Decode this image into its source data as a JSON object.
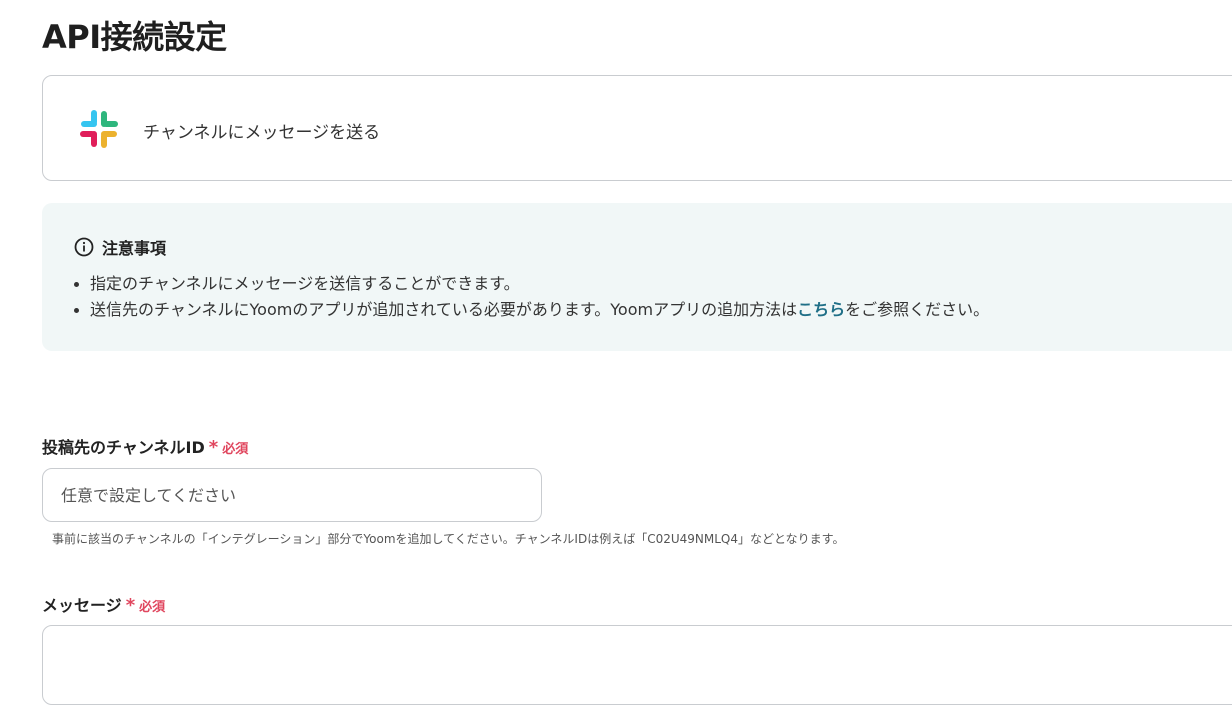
{
  "page": {
    "title": "API接続設定"
  },
  "action": {
    "label": "チャンネルにメッセージを送る",
    "app_icon": "slack-icon"
  },
  "notice": {
    "heading": "注意事項",
    "items": [
      {
        "text": "指定のチャンネルにメッセージを送信することができます。"
      },
      {
        "before": "送信先のチャンネルにYoomのアプリが追加されている必要があります。Yoomアプリの追加方法は",
        "link": "こちら",
        "after": "をご参照ください。"
      }
    ],
    "accent_color": "#1f6f87",
    "background_color": "#f1f7f7"
  },
  "fields": {
    "channel": {
      "label": "投稿先のチャンネルID",
      "required_mark": "*",
      "required_text": "必須",
      "placeholder": "任意で設定してください",
      "hint": "事前に該当のチャンネルの「インテグレーション」部分でYoomを追加してください。チャンネルIDは例えば「C02U49NMLQ4」などとなります。"
    },
    "message": {
      "label": "メッセージ",
      "required_mark": "*",
      "required_text": "必須"
    }
  },
  "colors": {
    "required": "#e0465e",
    "border": "#c9ccd0"
  }
}
